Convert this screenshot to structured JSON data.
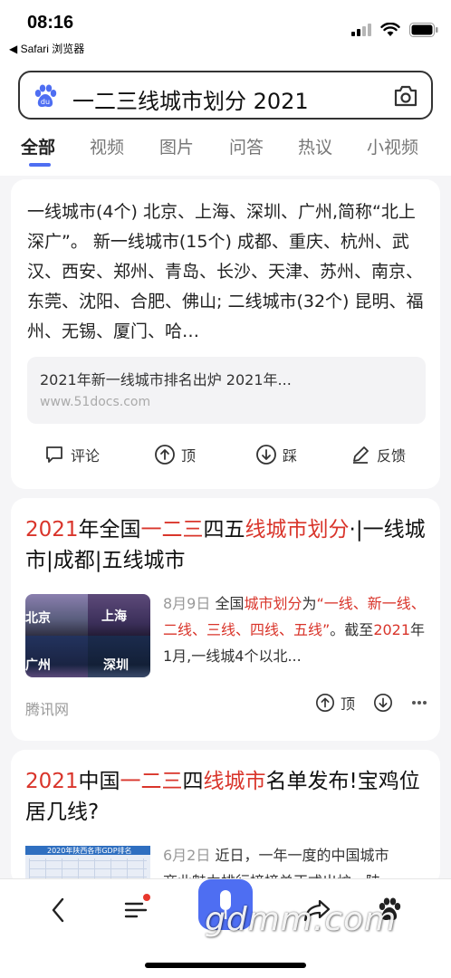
{
  "status_bar": {
    "time": "08:16",
    "back_app": "◀ Safari 浏览器"
  },
  "search": {
    "query": "一二三线城市划分 2021",
    "icon_left": "baidu-paw-icon",
    "icon_right": "camera-icon"
  },
  "tabs": [
    "全部",
    "视频",
    "图片",
    "问答",
    "热议",
    "小视频"
  ],
  "active_tab": "全部",
  "card1": {
    "text": "一线城市(4个) 北京、上海、深圳、广州,简称“北上深广”。 新一线城市(15个) 成都、重庆、杭州、武汉、西安、郑州、青岛、长沙、天津、苏州、南京、东莞、沈阳、合肥、佛山; 二线城市(32个) 昆明、福州、无锡、厦门、哈…",
    "source_title": "2021年新一线城市排名出炉 2021年...",
    "source_url": "www.51docs.com",
    "actions": [
      "评论",
      "顶",
      "踩",
      "反馈"
    ]
  },
  "card2": {
    "title_parts": [
      "2021",
      "年全国",
      "一二三",
      "四五",
      "线城市划分",
      "·|一线城市|成都|五线城市"
    ],
    "thumb_labels": [
      "北京",
      "上海",
      "广州",
      "深圳"
    ],
    "desc_date": "8月9日",
    "desc_parts": [
      "全国",
      "城市划分",
      "为",
      "“一线、新一线、二线、三线、四线、五线”",
      "。截至",
      "2021",
      "年1月,一线城4个以北..."
    ],
    "source": "腾讯网",
    "actions": [
      "顶"
    ]
  },
  "card3": {
    "title_parts": [
      "2021",
      "中国",
      "一二三",
      "四",
      "线城市",
      "名单发布!宝鸡位居几线?"
    ],
    "thumb_title": "2020年陕西各市GDP排名",
    "desc_date": "6月2日",
    "desc_line1": "近日，一年一度的中国城市",
    "desc_line2": "商业魅力排行榜榜单正式出炉，陕"
  },
  "watermark": "gdmm.com",
  "colors": {
    "accent": "#4e6ef2",
    "highlight": "#d9352b"
  }
}
